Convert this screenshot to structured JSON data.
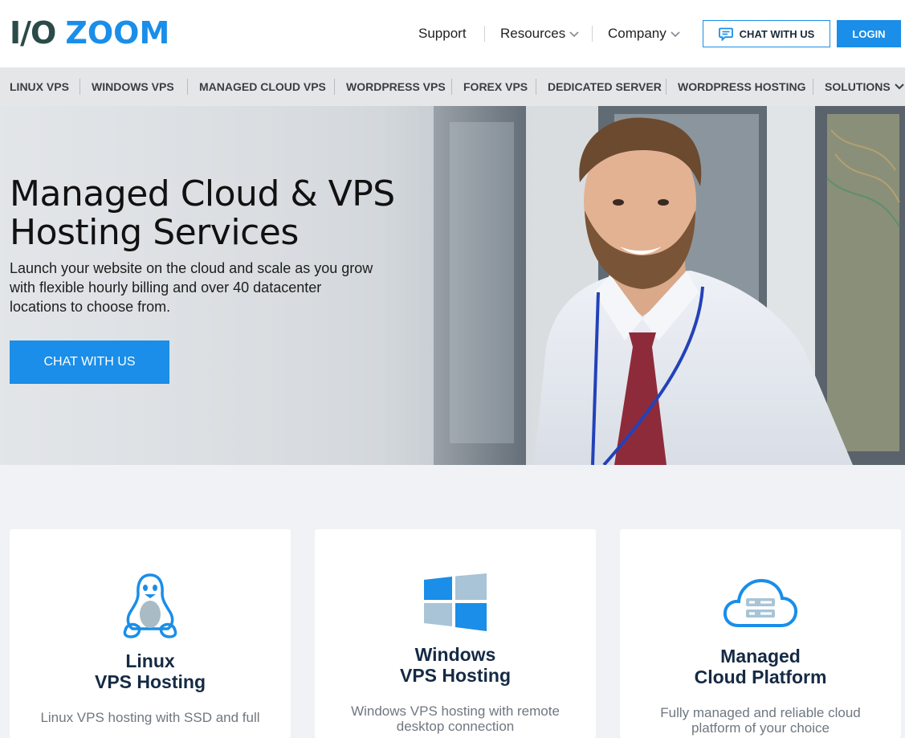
{
  "brand": {
    "logo_part1": "I/O",
    "logo_part2": "ZOOM"
  },
  "topnav": {
    "support": "Support",
    "resources": "Resources",
    "company": "Company",
    "chat_button": "CHAT WITH US",
    "login_button": "LOGIN"
  },
  "menu": [
    "LINUX VPS",
    "WINDOWS VPS",
    "MANAGED CLOUD VPS",
    "WORDPRESS VPS",
    "FOREX VPS",
    "DEDICATED SERVER",
    "WORDPRESS HOSTING",
    "SOLUTIONS"
  ],
  "hero": {
    "title": "Managed Cloud & VPS Hosting Services",
    "subtitle": "Launch your website on the cloud and scale as you grow with flexible hourly billing and over 40 datacenter locations to choose from.",
    "cta": "CHAT WITH US"
  },
  "cards": [
    {
      "title_line1": "Linux",
      "title_line2": "VPS Hosting",
      "desc": "Linux VPS hosting with SSD and full",
      "icon": "linux-penguin-icon"
    },
    {
      "title_line1": "Windows",
      "title_line2": "VPS Hosting",
      "desc": "Windows VPS hosting with remote desktop connection",
      "icon": "windows-logo-icon"
    },
    {
      "title_line1": "Managed",
      "title_line2": "Cloud Platform",
      "desc": "Fully managed and reliable cloud platform of your choice",
      "icon": "cloud-server-icon"
    }
  ],
  "colors": {
    "accent": "#1a8ee8",
    "logo_dark": "#2b4a49",
    "card_title": "#152a44",
    "menubar_bg": "#e5e6e8",
    "page_bg": "#f0f2f5"
  }
}
